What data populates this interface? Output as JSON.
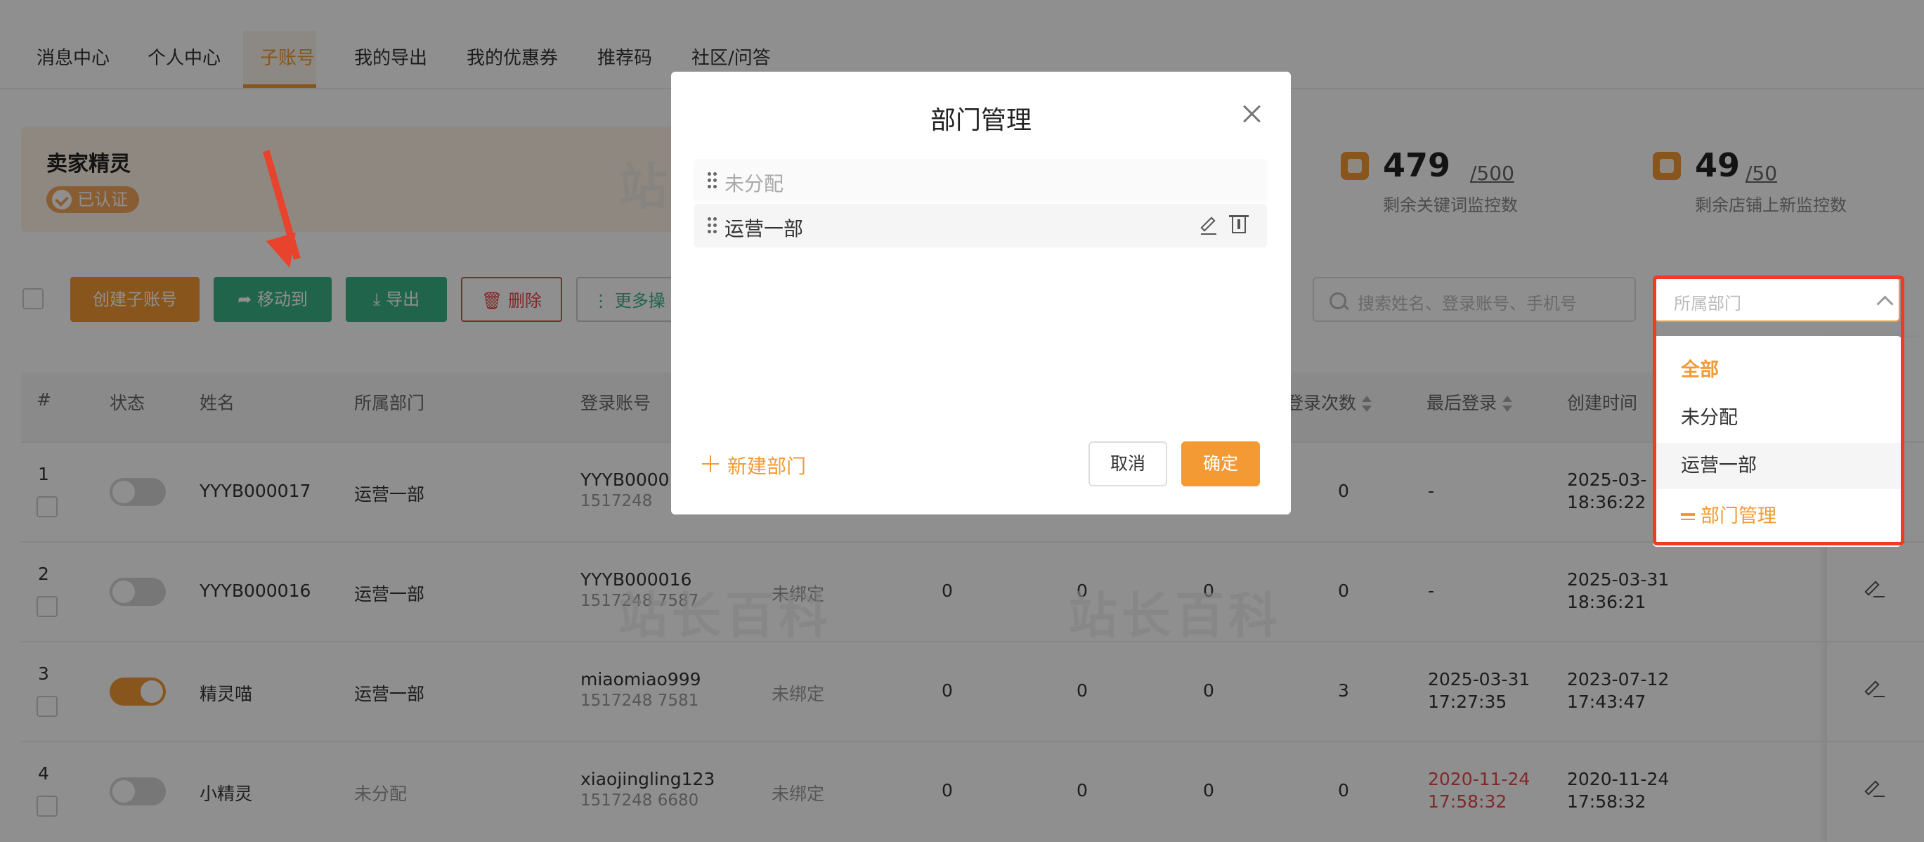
{
  "tabs": [
    "消息中心",
    "个人中心",
    "子账号",
    "我的导出",
    "我的优惠券",
    "推荐码",
    "社区/问答"
  ],
  "active_tab": "子账号",
  "seller": {
    "name": "卖家精灵",
    "badge": "已认证"
  },
  "stats": [
    {
      "value": "479",
      "total": "/500",
      "label": "剩余关键词监控数"
    },
    {
      "value": "49",
      "total": "/50",
      "label": "剩余店铺上新监控数"
    }
  ],
  "toolbar": {
    "create": "创建子账号",
    "move": "移动到",
    "export": "导出",
    "delete": "删除",
    "more": "更多操",
    "search_placeholder": "搜索姓名、登录账号、手机号",
    "dept_placeholder": "所属部门"
  },
  "table": {
    "headers": {
      "index": "#",
      "status": "状态",
      "name": "姓名",
      "dept": "所属部门",
      "account": "登录账号",
      "login_count": "登录次数",
      "last_login": "最后登录",
      "created": "创建时间"
    },
    "rows": [
      {
        "index": "1",
        "on": false,
        "name": "YYYB000017",
        "dept": "运营一部",
        "account": "YYYB0000",
        "phone": "1517248",
        "bind": "",
        "c1": "",
        "c2": "",
        "c3": "",
        "count": "0",
        "last": "-",
        "last2": "",
        "created1": "2025-03-",
        "created2": "18:36:22"
      },
      {
        "index": "2",
        "on": false,
        "name": "YYYB000016",
        "dept": "运营一部",
        "account": "YYYB000016",
        "phone": "1517248    7587",
        "bind": "未绑定",
        "c1": "0",
        "c2": "0",
        "c3": "0",
        "count": "0",
        "last": "-",
        "last2": "",
        "created1": "2025-03-31",
        "created2": "18:36:21"
      },
      {
        "index": "3",
        "on": true,
        "name": "精灵喵",
        "dept": "运营一部",
        "account": "miaomiao999",
        "phone": "1517248    7581",
        "bind": "未绑定",
        "c1": "0",
        "c2": "0",
        "c3": "0",
        "count": "3",
        "last": "2025-03-31",
        "last2": "17:27:35",
        "created1": "2023-07-12",
        "created2": "17:43:47"
      },
      {
        "index": "4",
        "on": false,
        "name": "小精灵",
        "dept": "未分配",
        "account": "xiaojingling123",
        "phone": "1517248    6680",
        "bind": "未绑定",
        "c1": "0",
        "c2": "0",
        "c3": "0",
        "count": "0",
        "last": "2020-11-24",
        "last2": "17:58:32",
        "created1": "2020-11-24",
        "created2": "17:58:32"
      }
    ]
  },
  "modal": {
    "title": "部门管理",
    "departments": [
      "未分配",
      "运营一部"
    ],
    "new_dept": "新建部门",
    "cancel": "取消",
    "ok": "确定"
  },
  "dropdown": {
    "options": [
      "全部",
      "未分配",
      "运营一部"
    ],
    "selected": "全部",
    "manage": "部门管理"
  },
  "watermark": "站长百科",
  "colors": {
    "accent": "#f39a34",
    "green": "#39b487",
    "danger": "#e34b4b",
    "highlight": "#ef3b24"
  }
}
